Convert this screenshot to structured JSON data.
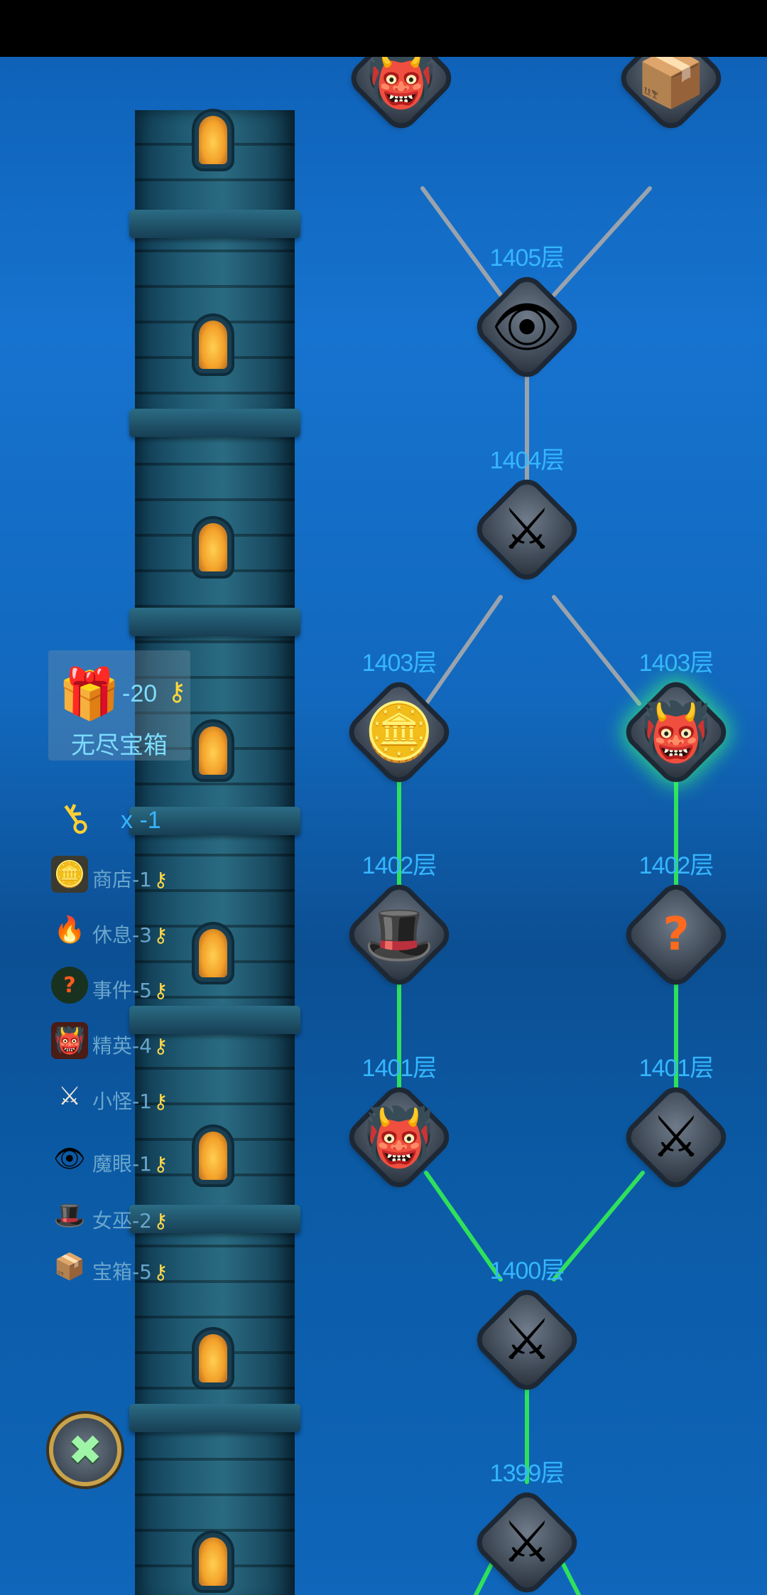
{
  "tower_floors": [
    {
      "floor_label": "1405层",
      "type": "magic_eye",
      "icon": "fire-eye-icon",
      "state": "locked"
    },
    {
      "floor_label": "1404层",
      "type": "minion",
      "icon": "crossed-swords-icon",
      "state": "locked"
    },
    {
      "floor_label": "1403层",
      "type": "shop",
      "icon": "coin-cards-icon",
      "state": "locked"
    },
    {
      "floor_label": "1403层",
      "type": "elite",
      "icon": "demon-mask-icon",
      "state": "current"
    },
    {
      "floor_label": "1402层",
      "type": "witch",
      "icon": "witch-hat-icon",
      "state": "visited"
    },
    {
      "floor_label": "1402层",
      "type": "event",
      "icon": "mystery-pot-icon",
      "state": "visited"
    },
    {
      "floor_label": "1401层",
      "type": "elite",
      "icon": "demon-mask-icon",
      "state": "visited"
    },
    {
      "floor_label": "1401层",
      "type": "minion",
      "icon": "crossed-swords-icon",
      "state": "visited"
    },
    {
      "floor_label": "1400层",
      "type": "minion",
      "icon": "crossed-swords-icon",
      "state": "visited"
    },
    {
      "floor_label": "1399层",
      "type": "minion",
      "icon": "crossed-swords-icon",
      "state": "visited"
    }
  ],
  "chest_panel": {
    "icon": "gift-box-icon",
    "cost": "-20",
    "name": "无尽宝箱"
  },
  "key_count": "x -1",
  "legend": [
    {
      "name": "商店",
      "cost": "-1",
      "icon": "coin-cards-icon"
    },
    {
      "name": "休息",
      "cost": "-3",
      "icon": "campfire-icon"
    },
    {
      "name": "事件",
      "cost": "-5",
      "icon": "mystery-pot-icon"
    },
    {
      "name": "精英",
      "cost": "-4",
      "icon": "demon-mask-icon"
    },
    {
      "name": "小怪",
      "cost": "-1",
      "icon": "crossed-swords-icon"
    },
    {
      "name": "魔眼",
      "cost": "-1",
      "icon": "fire-eye-icon"
    },
    {
      "name": "女巫",
      "cost": "-2",
      "icon": "witch-hat-icon"
    },
    {
      "name": "宝箱",
      "cost": "-5",
      "icon": "treasure-chest-icon"
    }
  ],
  "colors": {
    "path_visited": "#2fe05c",
    "path_locked": "#9aa3ad",
    "floor_label": "#35b6ff"
  }
}
